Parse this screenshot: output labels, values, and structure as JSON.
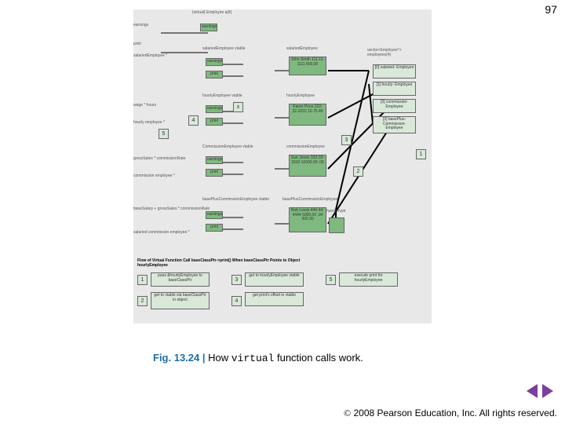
{
  "page_number": "97",
  "caption": {
    "fig": "Fig. 13.24",
    "sep": " | ",
    "text_before": "How ",
    "keyword": "virtual",
    "text_after": " function calls work."
  },
  "footer": {
    "copy": "©",
    "text": " 2008 Pearson Education, Inc.  All rights reserved."
  },
  "diagram": {
    "header": "{virtual}\nEmployee a[4]",
    "cols": {
      "c1": {
        "earnings": "earnings",
        "print": "print"
      },
      "c2": {
        "vtable1": "salariedEmployee\nvtable",
        "earnings": "earnings",
        "print": "print",
        "vtable2": "hourlyEmployee\nvtable",
        "vtable3": "CommissionEmployee\nvtable",
        "vtable4": "basePlusCommissionEmployee\nvtable"
      },
      "obj": {
        "o1": "John Smith\n111-11-1111\n800,00",
        "o2": "Karen Price\n222-22-2222\n16.75\n40",
        "o3": "Sue Jones\n333-33-3333\n10000.00\n.06",
        "o4": "Bob Lewis\n444-44-4444\n5000.00\n.04\n300.00",
        "t1": "salariedEmployee",
        "t2": "hourlyEmployee",
        "t3": "commissionEmployee",
        "t4": "basePlusCommissionEmployee"
      },
      "right": {
        "head": "vector<Employee*>\nemployees(4)",
        "r0": "[0]\nsalaried-\nEmployee",
        "r1": "[1]\nhourly-\nEmployee",
        "r2": "[2]\ncommission-\nEmployee",
        "r3": "[3]\nbasePlus-\nCommission-\nEmployee",
        "handle": "handle/vptr"
      }
    },
    "left_labels": {
      "l1": "earnings",
      "l2": "print",
      "l3": "salariedEmployee *",
      "l4": "wage * hours",
      "l5": "hourly employee *",
      "l6": "grossSales *\ncommissionRate",
      "l7": "commission employee *",
      "l8": "baseSalary +\ngrossSales *\ncommissionRate",
      "l9": "salaried\ncommission employee *"
    },
    "flow": {
      "title": "Flow of Virtual Function Call baseClassPtr->print()\nWhen baseClassPtr Points to Object hourlyEmployee",
      "b1": "pass &hourlyEmployee\nto baseClassPtr",
      "b2": "get to vtable via\nbaseClassPtr in\nobject",
      "b3": "get to hourlyEmployee\nvtable",
      "b4": "get print's offset\nin vtable",
      "b5": "execute print for\nhourlyEmployee"
    },
    "nums": {
      "n1": "1",
      "n2": "2",
      "n3": "3",
      "n4": "4",
      "n5": "5",
      "r1": "1",
      "r2": "2",
      "r3": "3"
    }
  }
}
